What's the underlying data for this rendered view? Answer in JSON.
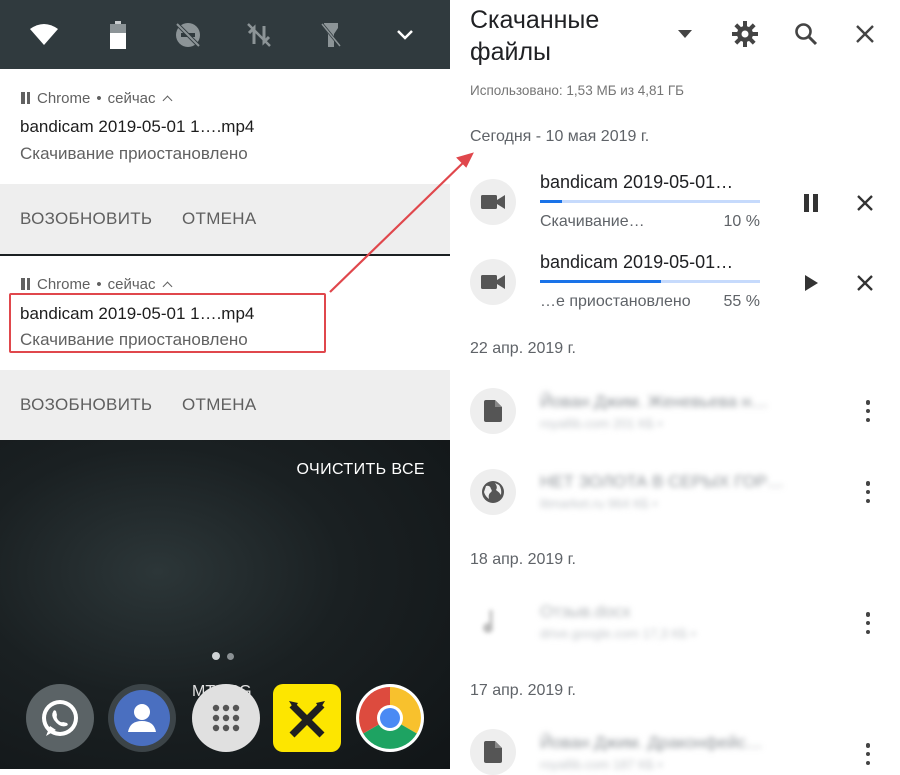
{
  "notification_shade": {
    "quick_settings": {
      "icons": [
        "wifi-icon",
        "battery-icon",
        "do-not-disturb-off-icon",
        "mobile-data-off-icon",
        "flashlight-off-icon",
        "expand-chevron-icon"
      ]
    },
    "notifications": [
      {
        "app": "Chrome",
        "time": "сейчас",
        "separator": "•",
        "title": "bandicam 2019-05-01 1….mp4",
        "subtitle": "Скачивание приостановлено",
        "actions": {
          "resume": "ВОЗОБНОВИТЬ",
          "cancel": "ОТМЕНА"
        }
      },
      {
        "app": "Chrome",
        "time": "сейчас",
        "separator": "•",
        "title": "bandicam 2019-05-01 1….mp4",
        "subtitle": "Скачивание приостановлено",
        "actions": {
          "resume": "ВОЗОБНОВИТЬ",
          "cancel": "ОТМЕНА"
        }
      }
    ],
    "clear_all": "ОЧИСТИТЬ ВСЕ",
    "carrier": "MTS 3G",
    "dock": [
      "whatsapp-icon",
      "contacts-icon",
      "app-drawer-icon",
      "raiffeisen-icon",
      "chrome-icon"
    ]
  },
  "downloads": {
    "title": "Скачанные файлы",
    "storage_info": "Использовано: 1,53 МБ из 4,81 ГБ",
    "sections": [
      {
        "date": "Сегодня - 10 мая 2019 г.",
        "items": [
          {
            "name": "bandicam 2019-05-01…",
            "status": "Скачивание…",
            "percent": "10 %",
            "progress": 0.1,
            "state": "downloading",
            "icon": "video-file-icon"
          },
          {
            "name": "bandicam 2019-05-01…",
            "status": "…е приостановлено",
            "percent": "55 %",
            "progress": 0.55,
            "state": "paused",
            "icon": "video-file-icon"
          }
        ]
      },
      {
        "date": "22 апр. 2019 г.",
        "items": [
          {
            "title": "Йован Джим. Женевьева н…",
            "sub": "royallib.com 201 КБ •",
            "icon": "document-icon"
          },
          {
            "title": "НЕТ ЗОЛОТА В СЕРЫХ ГОР…",
            "sub": "litmarket.ru 964 КБ •",
            "icon": "globe-icon"
          }
        ]
      },
      {
        "date": "18 апр. 2019 г.",
        "items": [
          {
            "title": "Отзыв.docx",
            "sub": "drive.google.com 17,3 КБ •",
            "icon": "audio-file-icon"
          }
        ]
      },
      {
        "date": "17 апр. 2019 г.",
        "items": [
          {
            "title": "Йован Джим. Драконфейс…",
            "sub": "royallib.com 187 КБ •",
            "icon": "document-icon"
          }
        ]
      }
    ]
  },
  "colors": {
    "accent_blue": "#1a73e8",
    "progress_track": "#c6dafc",
    "annotation_red": "#e0474c",
    "quick_settings_bg": "#303a3e"
  }
}
